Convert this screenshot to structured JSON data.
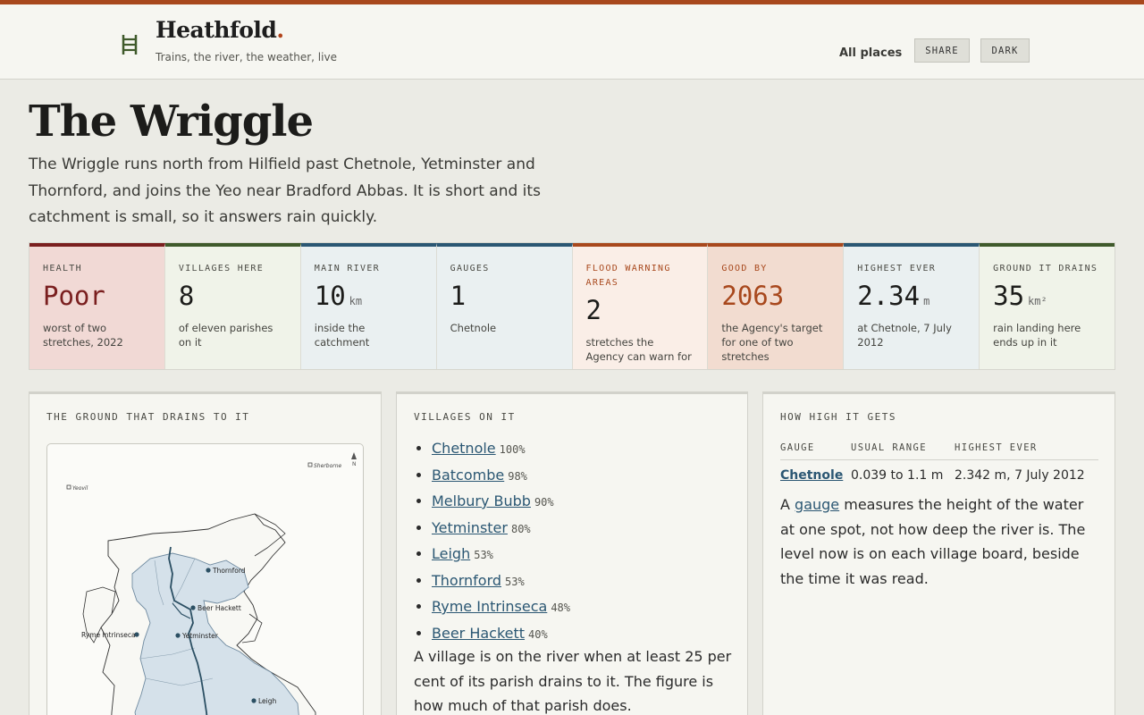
{
  "site": {
    "name": "Heathfold",
    "dot": ".",
    "tagline": "Trains, the river, the weather, live",
    "logo_icon": "ladder-icon"
  },
  "nav": {
    "all_places": "All places",
    "share": "SHARE",
    "dark": "DARK"
  },
  "page": {
    "title": "The Wriggle",
    "intro": "The Wriggle runs north from Hilfield past Chetnole, Yetminster and Thornford, and joins the Yeo near Bradford Abbas. It is short and its catchment is small, so it answers rain quickly."
  },
  "stats": [
    {
      "label": "HEALTH",
      "value": "Poor",
      "unit": "",
      "note": "worst of two stretches, 2022",
      "accent": "#7a1f1f",
      "bg": "#f1d9d5",
      "value_color": "#7a1f1f"
    },
    {
      "label": "VILLAGES HERE",
      "value": "8",
      "unit": "",
      "note": "of eleven parishes on it",
      "accent": "#3f5a2b",
      "bg": "#f0f3e9",
      "value_color": "#1c1c1a"
    },
    {
      "label": "MAIN RIVER",
      "value": "10",
      "unit": "km",
      "note": "inside the catchment",
      "accent": "#2b5773",
      "bg": "#eaf0f1",
      "value_color": "#1c1c1a"
    },
    {
      "label": "GAUGES",
      "value": "1",
      "unit": "",
      "note": "Chetnole",
      "accent": "#2b5773",
      "bg": "#eaf0f1",
      "value_color": "#1c1c1a"
    },
    {
      "label": "FLOOD WARNING AREAS",
      "value": "2",
      "unit": "",
      "note": "stretches the Agency can warn for",
      "accent": "#a8481d",
      "bg": "#faeee7",
      "value_color": "#1c1c1a",
      "label_color": "#a8481d"
    },
    {
      "label": "GOOD BY",
      "value": "2063",
      "unit": "",
      "note": "the Agency's target for one of two stretches",
      "accent": "#a8481d",
      "bg": "#f2dcd0",
      "value_color": "#a8481d",
      "label_color": "#a8481d"
    },
    {
      "label": "HIGHEST EVER",
      "value": "2.34",
      "unit": "m",
      "note": "at Chetnole, 7 July 2012",
      "accent": "#2b5773",
      "bg": "#eaf0f1",
      "value_color": "#1c1c1a"
    },
    {
      "label": "GROUND IT DRAINS",
      "value": "35",
      "unit": "km²",
      "note": "rain landing here ends up in it",
      "accent": "#3f5a2b",
      "bg": "#f0f3e9",
      "value_color": "#1c1c1a"
    }
  ],
  "map_card": {
    "title": "THE GROUND THAT DRAINS TO IT",
    "labels": {
      "sherborne": "Sherborne",
      "yeovil": "Yeovil",
      "north": "N",
      "thornford": "Thornford",
      "beer_hackett": "Beer Hackett",
      "ryme": "Ryme Intrinseca",
      "yetminster": "Yetminster",
      "leigh": "Leigh"
    }
  },
  "villages_card": {
    "title": "VILLAGES ON IT",
    "items": [
      {
        "name": "Chetnole",
        "pct": "100%"
      },
      {
        "name": "Batcombe",
        "pct": "98%"
      },
      {
        "name": "Melbury Bubb",
        "pct": "90%"
      },
      {
        "name": "Yetminster",
        "pct": "80%"
      },
      {
        "name": "Leigh",
        "pct": "53%"
      },
      {
        "name": "Thornford",
        "pct": "53%"
      },
      {
        "name": "Ryme Intrinseca",
        "pct": "48%"
      },
      {
        "name": "Beer Hackett",
        "pct": "40%"
      }
    ],
    "note": "A village is on the river when at least 25 per cent of its parish drains to it. The figure is how much of that parish does."
  },
  "high_card": {
    "title": "HOW HIGH IT GETS",
    "headers": {
      "gauge": "GAUGE",
      "usual": "USUAL RANGE",
      "highest": "HIGHEST EVER"
    },
    "row": {
      "gauge": "Chetnole",
      "usual": "0.039 to 1.1 m",
      "highest": "2.342 m, 7 July 2012"
    },
    "note_before": "A ",
    "note_link": "gauge",
    "note_after": " measures the height of the water at one spot, not how deep the river is. The level now is on each village board, beside the time it was read."
  }
}
